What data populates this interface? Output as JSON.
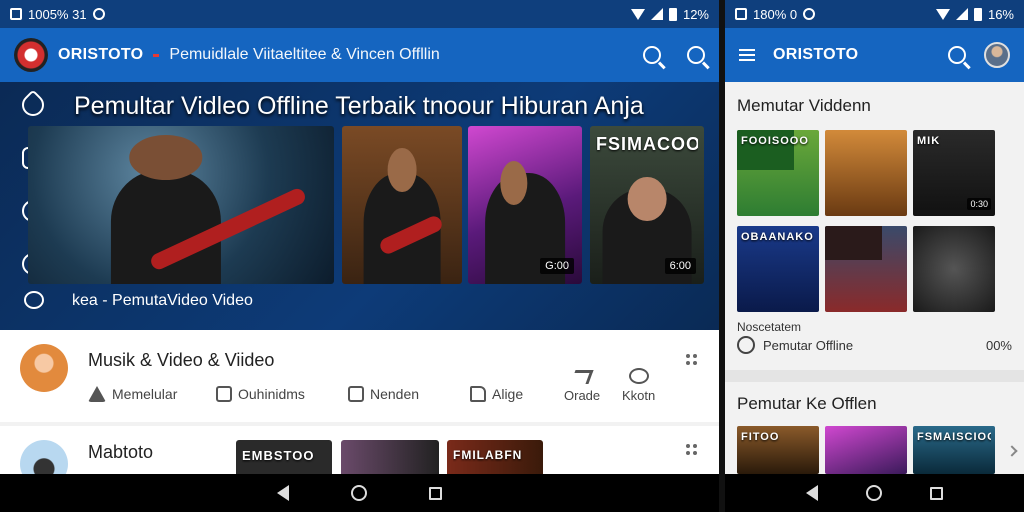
{
  "left": {
    "status": {
      "left_text": "1005% 31",
      "right_text": "12%"
    },
    "appbar": {
      "brand": "ORISTOTO",
      "title": "Pemuidlale Viitaeltitee & Vincen Offllin"
    },
    "hero": {
      "title": "Pemultar Vidleo Offline Terbaik tnoour Hiburan Anja",
      "caption": "kea - PemutaVideo Video",
      "thumbs": [
        {
          "text": "",
          "duration": ""
        },
        {
          "text": "",
          "duration": ""
        },
        {
          "text": "",
          "duration": "G:00"
        },
        {
          "text": "FSIMACOOP",
          "duration": "6:00"
        }
      ]
    },
    "card1": {
      "title": "Musik & Video & Viideo",
      "actions": [
        "Memelular",
        "Ouhinidms",
        "Nenden",
        "Alige"
      ],
      "vertical_actions": [
        "Orade",
        "Kkotn"
      ]
    },
    "card2": {
      "title": "Mabtoto",
      "thumbs": [
        "EMBSTOO",
        "",
        "FMILABFN"
      ]
    }
  },
  "right": {
    "status": {
      "left_text": "180% 0",
      "right_text": "16%"
    },
    "appbar": {
      "brand": "ORISTOTO"
    },
    "section1": {
      "title": "Memutar  Viddenn"
    },
    "grid": [
      {
        "text": "FOOISOOO",
        "duration": ""
      },
      {
        "text": "",
        "duration": ""
      },
      {
        "text": "MIK",
        "duration": "0:30"
      },
      {
        "text": "OBAANAKO",
        "duration": ""
      },
      {
        "text": "",
        "duration": ""
      },
      {
        "text": "",
        "duration": ""
      }
    ],
    "info_small": "Noscetatem",
    "info_text": "Pemutar Offline",
    "info_value": "00%",
    "section2": {
      "title": "Pemutar Ke Offlen"
    },
    "row2": [
      "FITOO",
      "",
      "FSMAISCIOO"
    ]
  }
}
